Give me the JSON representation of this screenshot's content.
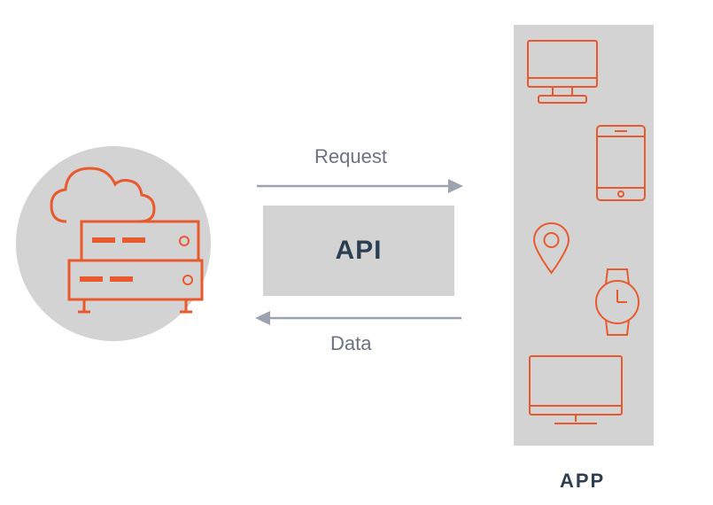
{
  "diagram": {
    "request_label": "Request",
    "data_label": "Data",
    "api_label": "API",
    "app_label": "APP"
  },
  "colors": {
    "icon_orange": "#E85A2E",
    "panel_gray": "#D3D3D3",
    "text_dark": "#2C3E50",
    "text_gray": "#6B7280",
    "arrow_gray": "#9CA3AF"
  },
  "devices": [
    "desktop",
    "smartphone",
    "location-pin",
    "smartwatch",
    "tv-monitor"
  ]
}
